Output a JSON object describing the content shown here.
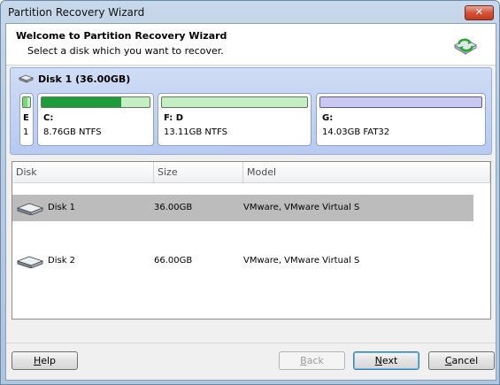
{
  "window": {
    "title": "Partition Recovery Wizard",
    "close_label": "✕"
  },
  "header": {
    "title": "Welcome to Partition Recovery Wizard",
    "subtitle": "Select a disk which you want to recover."
  },
  "disk_map": {
    "title": "Disk 1 (36.00GB)",
    "partitions": [
      {
        "label": "E",
        "info": "1",
        "used_fraction": 0.6,
        "bar_color": "#78d878"
      },
      {
        "label": "C:",
        "info": "8.76GB NTFS",
        "used_fraction": 0.74,
        "bar_color": "#1e9c3c"
      },
      {
        "label": "F: D",
        "info": "13.11GB NTFS",
        "used_fraction": 0.0,
        "bar_color": "#1e9c3c"
      },
      {
        "label": "G:",
        "info": "14.03GB FAT32",
        "used_fraction": 0.0,
        "bar_color": "#8c8cd8"
      }
    ]
  },
  "table": {
    "columns": [
      "Disk",
      "Size",
      "Model"
    ],
    "rows": [
      {
        "disk": "Disk 1",
        "size": "36.00GB",
        "model": "VMware, VMware Virtual S",
        "selected": true
      },
      {
        "disk": "Disk 2",
        "size": "66.00GB",
        "model": "VMware, VMware Virtual S",
        "selected": false
      }
    ]
  },
  "buttons": {
    "help": {
      "pre": "",
      "key": "H",
      "post": "elp"
    },
    "back": {
      "pre": "",
      "key": "B",
      "post": "ack"
    },
    "next": {
      "pre": "",
      "key": "N",
      "post": "ext"
    },
    "cancel": {
      "pre": "",
      "key": "C",
      "post": "ancel"
    }
  },
  "colors": {
    "selected_row": "#bcbcbc",
    "partition_track": "#c4eec4",
    "fat_track": "#c8c8f0"
  }
}
